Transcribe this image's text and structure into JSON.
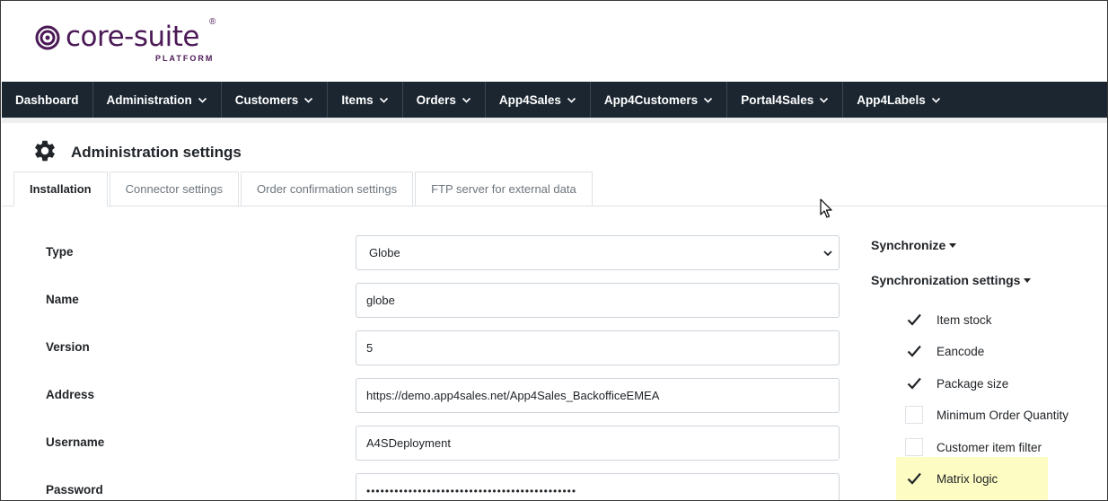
{
  "brand": {
    "name": "core-suite",
    "registered": "®",
    "subtitle": "PLATFORM",
    "color": "#4b1956"
  },
  "nav": {
    "items": [
      {
        "label": "Dashboard",
        "has_menu": false
      },
      {
        "label": "Administration",
        "has_menu": true
      },
      {
        "label": "Customers",
        "has_menu": true
      },
      {
        "label": "Items",
        "has_menu": true
      },
      {
        "label": "Orders",
        "has_menu": true
      },
      {
        "label": "App4Sales",
        "has_menu": true
      },
      {
        "label": "App4Customers",
        "has_menu": true
      },
      {
        "label": "Portal4Sales",
        "has_menu": true
      },
      {
        "label": "App4Labels",
        "has_menu": true
      }
    ],
    "background": "#1b2631"
  },
  "page": {
    "title": "Administration settings",
    "icon": "gear-icon"
  },
  "tabs": [
    {
      "label": "Installation",
      "active": true
    },
    {
      "label": "Connector settings",
      "active": false
    },
    {
      "label": "Order confirmation settings",
      "active": false
    },
    {
      "label": "FTP server for external data",
      "active": false
    }
  ],
  "form": {
    "type": {
      "label": "Type",
      "value": "Globe"
    },
    "name": {
      "label": "Name",
      "value": "globe"
    },
    "version": {
      "label": "Version",
      "value": "5"
    },
    "address": {
      "label": "Address",
      "value": "https://demo.app4sales.net/App4Sales_BackofficeEMEA"
    },
    "username": {
      "label": "Username",
      "value": "A4SDeployment"
    },
    "password": {
      "label": "Password",
      "value": "•••••••••••••••••••••••••••••••••••••••••••••"
    }
  },
  "sidebar": {
    "synchronize_label": "Synchronize",
    "sync_settings_label": "Synchronization settings",
    "options": [
      {
        "label": "Item stock",
        "checked": true
      },
      {
        "label": "Eancode",
        "checked": true
      },
      {
        "label": "Package size",
        "checked": true
      },
      {
        "label": "Minimum Order Quantity",
        "checked": false
      },
      {
        "label": "Customer item filter",
        "checked": false
      },
      {
        "label": "Matrix logic",
        "checked": true,
        "highlighted": true
      }
    ],
    "highlight_color": "#fdfcc2"
  }
}
